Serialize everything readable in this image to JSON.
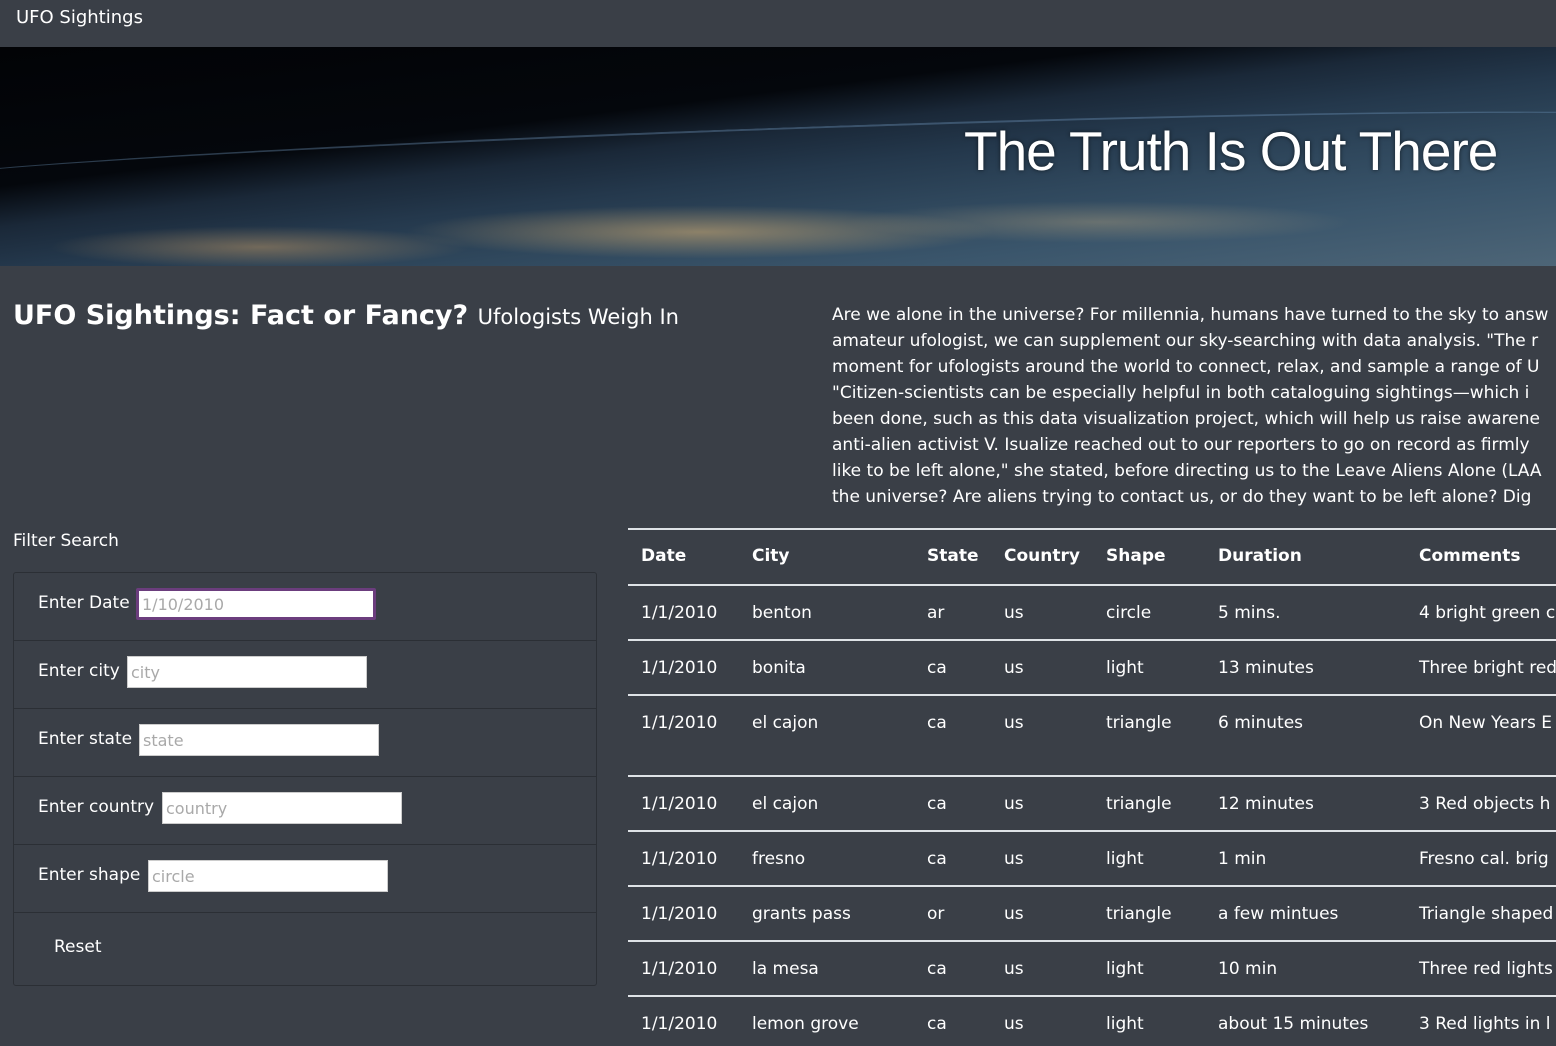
{
  "navbar": {
    "brand": "UFO Sightings"
  },
  "hero": {
    "title": "The Truth Is Out There"
  },
  "headline": {
    "title": "UFO Sightings: Fact or Fancy?",
    "subtitle": "Ufologists Weigh In"
  },
  "article": {
    "lines": [
      "Are we alone in the universe? For millennia, humans have turned to the sky to answ",
      "amateur ufologist, we can supplement our sky-searching with data analysis. \"The r",
      "moment for ufologists around the world to connect, relax, and sample a range of U",
      "\"Citizen-scientists can be especially helpful in both cataloguing sightings—which i",
      "been done, such as this data visualization project, which will help us raise awarene",
      "anti-alien activist V. Isualize reached out to our reporters to go on record as firmly",
      "like to be left alone,\" she stated, before directing us to the Leave Aliens Alone (LAA",
      "the universe? Are aliens trying to contact us, or do they want to be left alone? Dig"
    ]
  },
  "filter": {
    "heading": "Filter Search",
    "fields": [
      {
        "label": "Enter Date",
        "placeholder": "1/10/2010",
        "value": ""
      },
      {
        "label": "Enter city",
        "placeholder": "city",
        "value": ""
      },
      {
        "label": "Enter state",
        "placeholder": "state",
        "value": ""
      },
      {
        "label": "Enter country",
        "placeholder": "country",
        "value": ""
      },
      {
        "label": "Enter shape",
        "placeholder": "circle",
        "value": ""
      }
    ],
    "reset_label": "Reset"
  },
  "table": {
    "headers": [
      "Date",
      "City",
      "State",
      "Country",
      "Shape",
      "Duration",
      "Comments"
    ],
    "rows": [
      [
        "1/1/2010",
        "benton",
        "ar",
        "us",
        "circle",
        "5 mins.",
        "4 bright green c"
      ],
      [
        "1/1/2010",
        "bonita",
        "ca",
        "us",
        "light",
        "13 minutes",
        "Three bright red"
      ],
      [
        "1/1/2010",
        "el cajon",
        "ca",
        "us",
        "triangle",
        "6 minutes",
        "On New Years E lights above my"
      ],
      [
        "1/1/2010",
        "el cajon",
        "ca",
        "us",
        "triangle",
        "12 minutes",
        "3 Red objects h"
      ],
      [
        "1/1/2010",
        "fresno",
        "ca",
        "us",
        "light",
        "1 min",
        "Fresno cal. brig"
      ],
      [
        "1/1/2010",
        "grants pass",
        "or",
        "us",
        "triangle",
        "a few mintues",
        "Triangle shaped"
      ],
      [
        "1/1/2010",
        "la mesa",
        "ca",
        "us",
        "light",
        "10 min",
        "Three red lights"
      ],
      [
        "1/1/2010",
        "lemon grove",
        "ca",
        "us",
        "light",
        "about 15 minutes",
        "3 Red lights in l"
      ]
    ]
  }
}
